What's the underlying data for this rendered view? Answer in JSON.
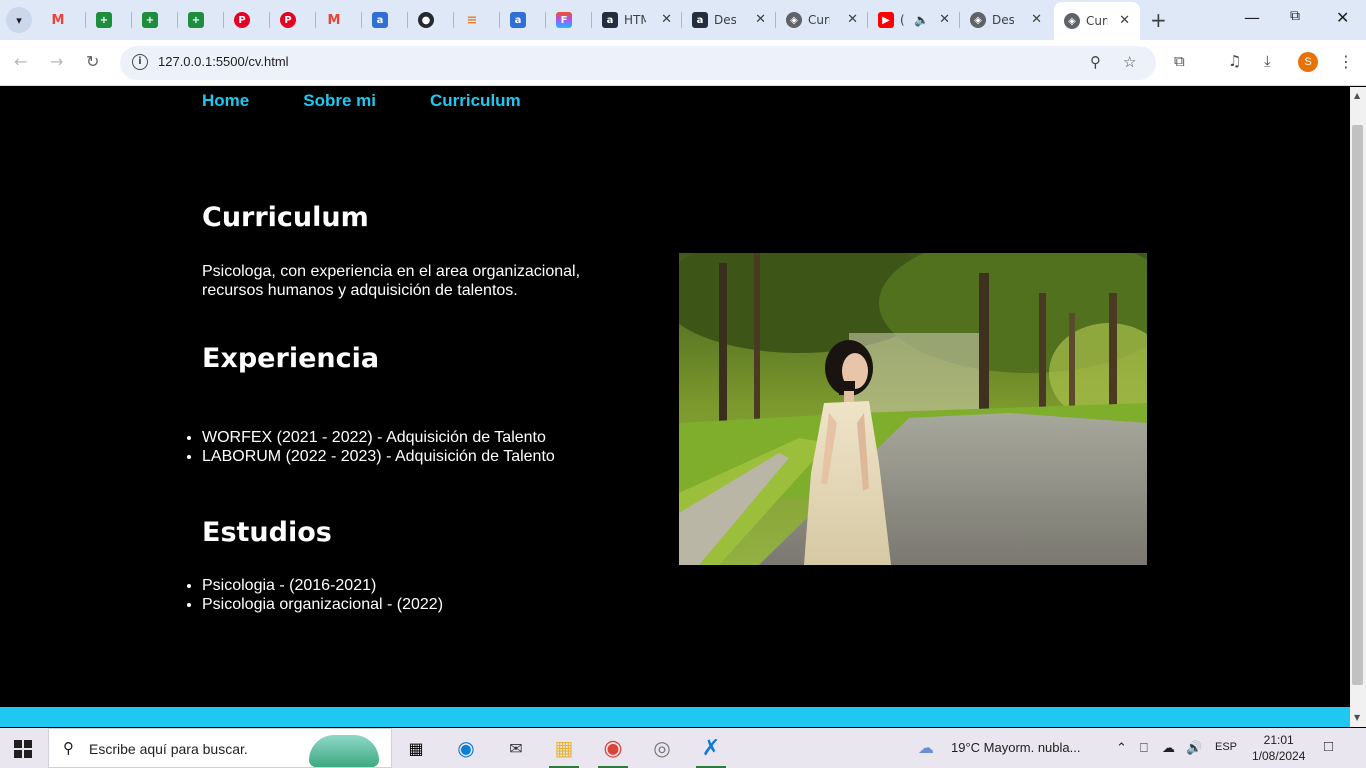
{
  "browser": {
    "tabs": [
      {
        "icon": "gmail-icon",
        "title": ""
      },
      {
        "icon": "sheets-icon",
        "title": ""
      },
      {
        "icon": "sheets-icon",
        "title": ""
      },
      {
        "icon": "sheets-icon",
        "title": ""
      },
      {
        "icon": "pinterest-icon",
        "title": ""
      },
      {
        "icon": "pinterest-icon",
        "title": ""
      },
      {
        "icon": "gmail-icon",
        "title": ""
      },
      {
        "icon": "amazon-icon",
        "title": ""
      },
      {
        "icon": "github-icon",
        "title": ""
      },
      {
        "icon": "stackoverflow-icon",
        "title": ""
      },
      {
        "icon": "amazon-icon",
        "title": ""
      },
      {
        "icon": "figma-icon",
        "title": ""
      },
      {
        "icon": "amazon-dark-icon",
        "title": "HTM"
      },
      {
        "icon": "amazon-dark-icon",
        "title": "Des"
      },
      {
        "icon": "globe-icon",
        "title": "Curr"
      },
      {
        "icon": "youtube-icon",
        "title": "("
      },
      {
        "icon": "globe-icon",
        "title": "Des"
      },
      {
        "icon": "globe-icon",
        "title": "Curr"
      }
    ],
    "url": "127.0.0.1:5500/cv.html",
    "profile_initial": "S"
  },
  "site": {
    "nav": [
      "Home",
      "Sobre mi",
      "Curriculum"
    ],
    "title": "Curriculum",
    "summary": "Psicologa, con experiencia en el area organizacional, recursos humanos y adquisición de talentos.",
    "experience_title": "Experiencia",
    "experience": [
      "WORFEX (2021 - 2022) - Adquisición de Talento",
      "LABORUM (2022 - 2023) - Adquisición de Talento"
    ],
    "studies_title": "Estudios",
    "studies": [
      "Psicologia - (2016-2021)",
      "Psicologia organizacional - (2022)"
    ]
  },
  "taskbar": {
    "search_placeholder": "Escribe aquí para buscar.",
    "weather": "19°C  Mayorm. nubla...",
    "language": "ESP",
    "time": "21:01",
    "date": "1/08/2024"
  },
  "colors": {
    "accent": "#1ec8f0",
    "page_bg": "#000000"
  }
}
